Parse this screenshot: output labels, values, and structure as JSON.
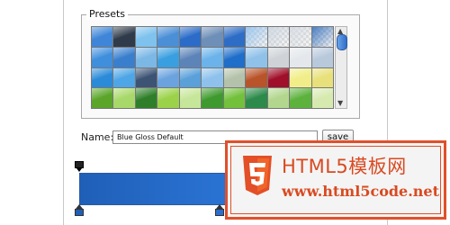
{
  "presets": {
    "legend": "Presets",
    "swatches": [
      [
        "#3f86d8",
        "#2f3b4a",
        "#7fc2ee",
        "#4b8fd7",
        "#2c6cc8",
        "#6e8fb8",
        "#2e6dc6",
        "#9cc6ef",
        "#cfd8e2",
        "#d8dde3",
        "#4a7fc4"
      ],
      [
        "#3f8fdd",
        "#3a7fcd",
        "#7cb8e6",
        "#3a9fe0",
        "#5d84b8",
        "#6bb3ea",
        "#1f6ec9",
        "#8fc1e9",
        "#cfd3d8",
        "#e4e8ec",
        "#b9c9dc"
      ],
      [
        "#2b8bd8",
        "#4fa6e6",
        "#3c5374",
        "#6ba3df",
        "#5aa0d9",
        "#8ec2ec",
        "#b5c2ab",
        "#b9542a",
        "#a0102a",
        "#f1ee8a",
        "#e8e07a"
      ],
      [
        "#5aa52a",
        "#a8d86a",
        "#2f7f2a",
        "#9bd24a",
        "#c6e69a",
        "#3e9a2e",
        "#73c03c",
        "#2c8a4a",
        "#b2d68e",
        "#5db23e",
        "#d6eab0"
      ]
    ],
    "checker_swatches": [
      "0-7",
      "0-8",
      "0-9",
      "0-10"
    ],
    "scrollbar": {
      "up_arrow": "▲",
      "down_arrow": "▼"
    }
  },
  "name_field": {
    "label": "Name:",
    "value": "Blue Gloss Default"
  },
  "save_button": {
    "label": "save"
  },
  "gradient": {
    "start_color": "#1f5fb8",
    "end_color": "#2b74d4",
    "stops": [
      {
        "color": "#1f5fb8",
        "location": 0.0
      },
      {
        "color": "#2a6fce",
        "location": 0.92
      }
    ]
  },
  "watermark": {
    "title": "HTML5模板网",
    "url": "www.html5code.net",
    "accent": "#e0502a"
  }
}
